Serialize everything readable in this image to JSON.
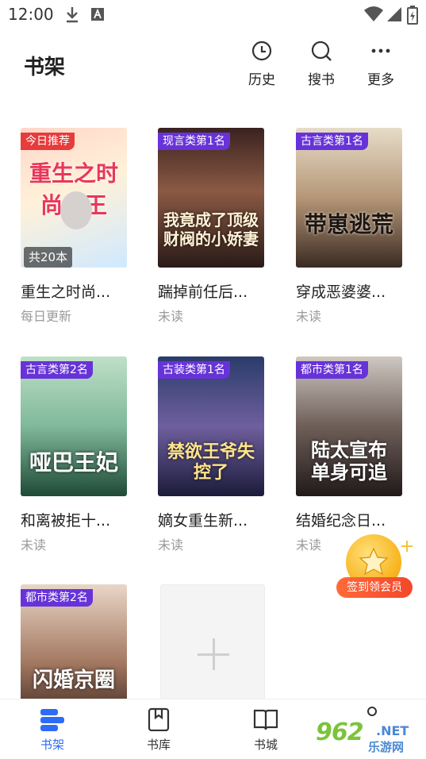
{
  "status_bar": {
    "time": "12:00"
  },
  "header": {
    "title": "书架",
    "actions": [
      {
        "label": "历史",
        "icon": "clock-icon"
      },
      {
        "label": "搜书",
        "icon": "search-icon"
      },
      {
        "label": "更多",
        "icon": "more-dots-icon"
      }
    ]
  },
  "books": [
    {
      "title": "重生之时尚...",
      "status": "每日更新",
      "tag": "今日推荐",
      "tag_color": "#e83b3b",
      "count_badge": "共20本",
      "cover_text": "重生之时尚女王"
    },
    {
      "title": "踹掉前任后...",
      "status": "未读",
      "tag": "现言类第1名",
      "tag_color": "#6733d9",
      "cover_text": "我竟成了顶级财阀的小娇妻"
    },
    {
      "title": "穿成恶婆婆...",
      "status": "未读",
      "tag": "古言类第1名",
      "tag_color": "#6733d9",
      "cover_text": "带崽逃荒"
    },
    {
      "title": "和离被拒十...",
      "status": "未读",
      "tag": "古言类第2名",
      "tag_color": "#6733d9",
      "cover_text": "哑巴王妃"
    },
    {
      "title": "嫡女重生新...",
      "status": "未读",
      "tag": "古装类第1名",
      "tag_color": "#6733d9",
      "cover_text": "禁欲王爷失控了"
    },
    {
      "title": "结婚纪念日...",
      "status": "未读",
      "tag": "都市类第1名",
      "tag_color": "#6733d9",
      "cover_text": "陆太宣布单身可追"
    },
    {
      "title": "",
      "status": "",
      "tag": "都市类第2名",
      "tag_color": "#6733d9",
      "cover_text": "闪婚京圈"
    }
  ],
  "signin": {
    "label": "签到领会员"
  },
  "bottom_nav": [
    {
      "label": "书架",
      "icon": "bookshelf-icon",
      "active": true
    },
    {
      "label": "书库",
      "icon": "bookmark-book-icon",
      "active": false
    },
    {
      "label": "书城",
      "icon": "open-book-icon",
      "active": false
    }
  ],
  "watermark": {
    "logo": "962",
    "net": ".NET",
    "sub": "乐游网"
  },
  "colors": {
    "accent": "#2d6cf6",
    "tag": "#6733d9",
    "recommend_tag": "#e83b3b",
    "signin": "#f2472b"
  }
}
